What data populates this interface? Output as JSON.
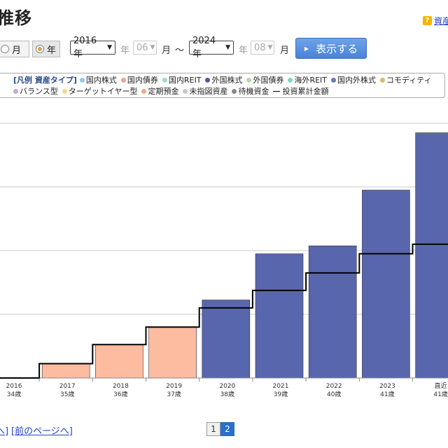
{
  "header": {
    "title": "推移",
    "help_link": "資産"
  },
  "controls": {
    "month_label": "月",
    "year_label": "年",
    "from_year": "2016 年",
    "from_year_unit": "年",
    "from_month": "06",
    "from_month_unit": "月",
    "tilde": "～",
    "to_year": "2024 年",
    "to_year_unit": "年",
    "to_month": "08",
    "to_month_unit": "月",
    "show_button": "表示する"
  },
  "legend": {
    "title": "[凡例 資産タイプ]",
    "items": [
      {
        "label": "国内株式",
        "color": "#8fc9e6",
        "shape": "dot"
      },
      {
        "label": "国内債券",
        "color": "#f4a090",
        "shape": "dot"
      },
      {
        "label": "国内REIT",
        "color": "#a0d8c8",
        "shape": "dot"
      },
      {
        "label": "外国株式",
        "color": "#4a58a8",
        "shape": "dot"
      },
      {
        "label": "外国債券",
        "color": "#b8d8a8",
        "shape": "dot"
      },
      {
        "label": "海外REIT",
        "color": "#78d8c0",
        "shape": "dot"
      },
      {
        "label": "国内外株式",
        "color": "#6a7ab8",
        "shape": "dot"
      },
      {
        "label": "コモディティ",
        "color": "#d8b870",
        "shape": "dot"
      },
      {
        "label": "バランス型",
        "color": "#b8b0e0",
        "shape": "dot"
      },
      {
        "label": "ターゲットイヤー型",
        "color": "#f0d890",
        "shape": "dot"
      },
      {
        "label": "定期預金",
        "color": "#f4a880",
        "shape": "dot"
      },
      {
        "label": "未指図資産",
        "color": "#c8c8c8",
        "shape": "dot"
      },
      {
        "label": "待機資金",
        "color": "#888888",
        "shape": "dot"
      },
      {
        "label": "投資累計金額",
        "color": "#000000",
        "shape": "line"
      }
    ]
  },
  "chart_data": {
    "type": "bar",
    "categories": [
      "2016",
      "2017",
      "2018",
      "2019",
      "2020",
      "2021",
      "2022",
      "2023",
      "直近"
    ],
    "ages": [
      "34歳",
      "35歳",
      "36歳",
      "37歳",
      "38歳",
      "39歳",
      "40歳",
      "41歳",
      "41歳"
    ],
    "series": [
      {
        "name": "定期預金",
        "color": "#fdbba0",
        "values": [
          0,
          0.9,
          2.1,
          3.2,
          0,
          0,
          0,
          0,
          0
        ]
      },
      {
        "name": "外国株式",
        "color": "#5866ae",
        "values": [
          0,
          0,
          0,
          0,
          4.9,
          7.8,
          8.3,
          11.8,
          15.4
        ]
      }
    ],
    "line": {
      "name": "投資累計金額",
      "values": [
        0,
        0.9,
        2.1,
        3.2,
        4.4,
        5.5,
        6.6,
        7.8,
        8.4
      ]
    },
    "ylim": [
      0,
      16
    ],
    "grid_step": 4,
    "grid": true
  },
  "pager": {
    "prev_link": "前のページへ]",
    "prev_link2": "[前のページへ]",
    "pages": [
      "1",
      "2"
    ],
    "current": "2"
  }
}
